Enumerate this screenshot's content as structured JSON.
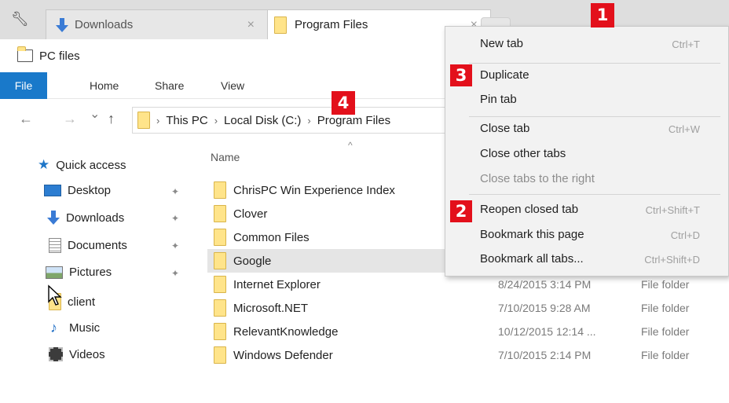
{
  "tabs": {
    "downloads": {
      "label": "Downloads"
    },
    "program_files": {
      "label": "Program Files"
    },
    "close_glyph": "×"
  },
  "titlebar": {
    "title": "PC files"
  },
  "ribbon": {
    "file": "File",
    "home": "Home",
    "share": "Share",
    "view": "View"
  },
  "nav": {
    "back": "←",
    "forward": "→",
    "recent": "⌄",
    "up": "↑"
  },
  "address": {
    "crumbs": [
      "This PC",
      "Local Disk (C:)",
      "Program Files"
    ],
    "separator": "›"
  },
  "column_header": {
    "name": "Name",
    "sort": "^"
  },
  "sidebar": {
    "quick_access": "Quick access",
    "items": [
      {
        "label": "Desktop",
        "pinned": true
      },
      {
        "label": "Downloads",
        "pinned": true
      },
      {
        "label": "Documents",
        "pinned": true
      },
      {
        "label": "Pictures",
        "pinned": true
      },
      {
        "label": "client",
        "pinned": false
      },
      {
        "label": "Music",
        "pinned": false
      },
      {
        "label": "Videos",
        "pinned": false
      }
    ],
    "pin_glyph": "✦"
  },
  "files": [
    {
      "name": "ChrisPC Win Experience Index",
      "date": "",
      "type": ""
    },
    {
      "name": "Clover",
      "date": "",
      "type": ""
    },
    {
      "name": "Common Files",
      "date": "",
      "type": ""
    },
    {
      "name": "Google",
      "date": "",
      "type": ""
    },
    {
      "name": "Internet Explorer",
      "date": "8/24/2015 3:14 PM",
      "type": "File folder"
    },
    {
      "name": "Microsoft.NET",
      "date": "7/10/2015 9:28 AM",
      "type": "File folder"
    },
    {
      "name": "RelevantKnowledge",
      "date": "10/12/2015 12:14 ...",
      "type": "File folder"
    },
    {
      "name": "Windows Defender",
      "date": "7/10/2015 2:14 PM",
      "type": "File folder"
    }
  ],
  "context_menu": {
    "new_tab": {
      "label": "New tab",
      "shortcut": "Ctrl+T"
    },
    "duplicate": {
      "label": "Duplicate"
    },
    "pin_tab": {
      "label": "Pin tab"
    },
    "close_tab": {
      "label": "Close tab",
      "shortcut": "Ctrl+W"
    },
    "close_other": {
      "label": "Close other tabs"
    },
    "close_right": {
      "label": "Close tabs to the right",
      "disabled": true
    },
    "reopen": {
      "label": "Reopen closed tab",
      "shortcut": "Ctrl+Shift+T"
    },
    "bookmark_page": {
      "label": "Bookmark this page",
      "shortcut": "Ctrl+D"
    },
    "bookmark_all": {
      "label": "Bookmark all tabs...",
      "shortcut": "Ctrl+Shift+D"
    }
  },
  "callouts": {
    "one": "1",
    "two": "2",
    "three": "3",
    "four": "4"
  },
  "colors": {
    "ribbon_file": "#1979ca",
    "callout": "#e3101b",
    "folder": "#ffe48a"
  }
}
